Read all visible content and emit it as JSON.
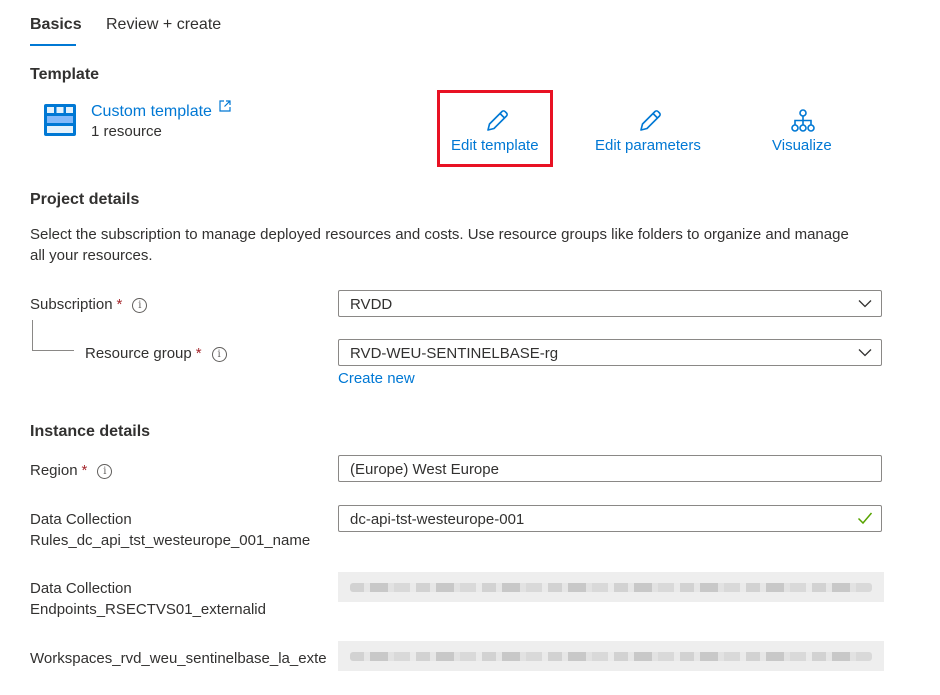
{
  "tabs": [
    {
      "label": "Basics",
      "active": true
    },
    {
      "label": "Review + create",
      "active": false
    }
  ],
  "template": {
    "section_title": "Template",
    "name": "Custom template",
    "resource_count": "1 resource",
    "actions": {
      "edit_template": "Edit template",
      "edit_parameters": "Edit parameters",
      "visualize": "Visualize"
    }
  },
  "project": {
    "section_title": "Project details",
    "description": "Select the subscription to manage deployed resources and costs. Use resource groups like folders to organize and manage all your resources.",
    "subscription": {
      "label": "Subscription",
      "required": "*",
      "value": "RVDD"
    },
    "resource_group": {
      "label": "Resource group",
      "required": "*",
      "value": "RVD-WEU-SENTINELBASE-rg",
      "create_new": "Create new"
    }
  },
  "instance": {
    "section_title": "Instance details",
    "region": {
      "label": "Region",
      "required": "*",
      "value": "(Europe) West Europe"
    },
    "dcr_name": {
      "label_line1": "Data Collection",
      "label_line2": "Rules_dc_api_tst_westeurope_001_name",
      "value": "dc-api-tst-westeurope-001"
    },
    "dce_id": {
      "label_line1": "Data Collection",
      "label_line2": "Endpoints_RSECTVS01_externalid"
    },
    "workspace": {
      "label": "Workspaces_rvd_weu_sentinelbase_la_exte"
    }
  },
  "icons": {
    "info": "i",
    "template": "template-grid-icon",
    "external_link": "external-link-icon",
    "pencil": "pencil-icon",
    "visualize": "hierarchy-icon",
    "chevron": "chevron-down-icon",
    "valid": "checkmark-icon"
  },
  "colors": {
    "accent": "#0078d4",
    "required": "#a4262c",
    "highlight": "#e81123",
    "valid": "#57a300"
  }
}
